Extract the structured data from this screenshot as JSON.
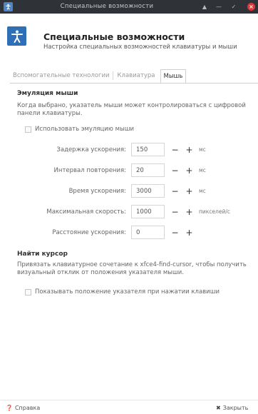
{
  "window": {
    "title": "Специальные возможности",
    "controls": [
      "minimize-icon",
      "maximize-icon",
      "close-icon"
    ]
  },
  "header": {
    "title": "Специальные возможности",
    "subtitle": "Настройка специальных возможностей клавиатуры и мыши",
    "icon": "accessibility-icon"
  },
  "tabs": [
    {
      "label": "Вспомогательные технологии",
      "active": false
    },
    {
      "label": "Клавиатура",
      "active": false
    },
    {
      "label": "Мышь",
      "active": true
    }
  ],
  "mouse_emulation": {
    "title": "Эмуляция мыши",
    "description": "Когда выбрано, указатель мыши может контролироваться с цифровой панели клавиатуры.",
    "checkbox_label": "Использовать эмуляцию мыши",
    "fields": [
      {
        "label": "Задержка ускорения:",
        "value": "150",
        "unit": "мс"
      },
      {
        "label": "Интервал повторения:",
        "value": "20",
        "unit": "мс"
      },
      {
        "label": "Время ускорения:",
        "value": "3000",
        "unit": "мс"
      },
      {
        "label": "Максимальная скорость:",
        "value": "1000",
        "unit": "пикселей/с"
      },
      {
        "label": "Расстояние ускорения:",
        "value": "0",
        "unit": ""
      }
    ],
    "minus_label": "−",
    "plus_label": "+"
  },
  "find_cursor": {
    "title": "Найти курсор",
    "description": "Привязать клавиатурное сочетание к xfce4-find-cursor, чтобы получить визуальный отклик от положения указателя мыши.",
    "checkbox_label": "Показывать положение указателя при нажатии клавиши"
  },
  "buttons": {
    "help_label": "Справка",
    "close_label": "Закрыть"
  }
}
